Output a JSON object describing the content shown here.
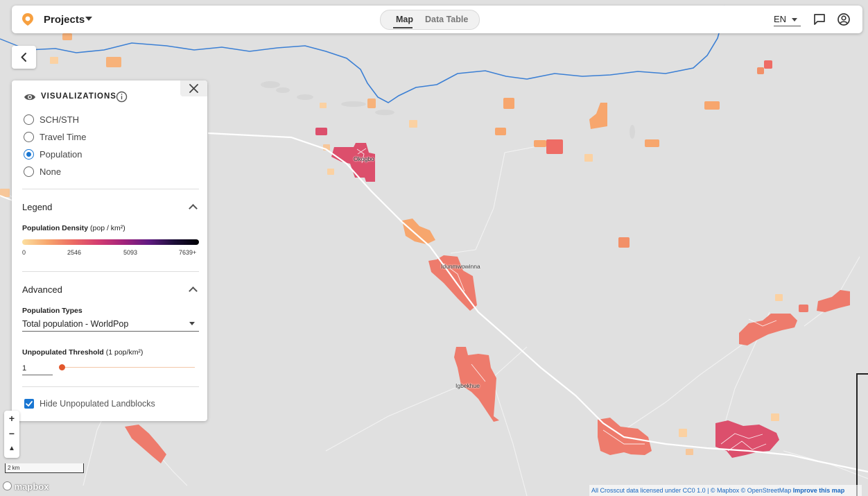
{
  "header": {
    "project_label": "Projects",
    "tabs": [
      {
        "label": "Map",
        "active": true
      },
      {
        "label": "Data Table",
        "active": false
      }
    ],
    "language": "EN"
  },
  "panel": {
    "title": "VISUALIZATIONS",
    "options": [
      {
        "label": "SCH/STH",
        "selected": false
      },
      {
        "label": "Travel Time",
        "selected": false
      },
      {
        "label": "Population",
        "selected": true
      },
      {
        "label": "None",
        "selected": false
      }
    ],
    "legend": {
      "heading": "Legend",
      "title": "Population Density",
      "unit": "(pop / km²)",
      "ticks": [
        "0",
        "2546",
        "5093",
        "7639+"
      ]
    },
    "advanced": {
      "heading": "Advanced",
      "population_types_label": "Population Types",
      "population_type_value": "Total population - WorldPop",
      "threshold_label": "Unpopulated Threshold",
      "threshold_unit": "(1 pop/km²)",
      "threshold_value": "1",
      "hide_label": "Hide Unpopulated Landblocks",
      "hide_checked": true
    }
  },
  "map": {
    "places": [
      "Okogbo",
      "Idunmwowinna",
      "Igbekhue"
    ],
    "scale_label": "2 km",
    "logo_text": "mapbox",
    "attribution": "All Crosscut data licensed under CC0 1.0 | © Mapbox © OpenStreetMap",
    "improve_link": "Improve this map",
    "zoom_in": "+",
    "zoom_out": "−",
    "compass": "▲",
    "colors": {
      "river": "#3b7fd4",
      "road": "#ffffff",
      "density_low": "#f7b27a",
      "density_mid": "#ee7b6c",
      "density_high": "#dc4f6c"
    }
  }
}
